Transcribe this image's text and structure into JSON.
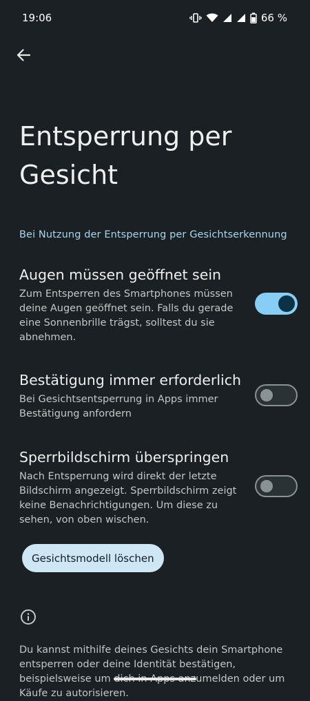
{
  "status_bar": {
    "time": "19:06",
    "battery_percent": "66 %",
    "icons": [
      "vibrate-icon",
      "wifi-icon",
      "signal-icon",
      "signal-icon",
      "battery-icon"
    ]
  },
  "nav": {
    "back_icon": "arrow-back-icon"
  },
  "page": {
    "title": "Entsperrung per Gesicht",
    "section_header": "Bei Nutzung der Entsperrung per Gesichtserkennung"
  },
  "settings": [
    {
      "title": "Augen müssen geöffnet sein",
      "summary": "Zum Entsperren des Smartphones müssen deine Augen geöffnet sein. Falls du gerade eine Sonnenbrille trägst, solltest du sie abnehmen.",
      "enabled": true
    },
    {
      "title": "Bestätigung immer erforderlich",
      "summary": "Bei Gesichtsentsperrung in Apps immer Bestätigung anfordern",
      "enabled": false
    },
    {
      "title": "Sperrbildschirm überspringen",
      "summary": "Nach Entsperrung wird direkt der letzte Bildschirm angezeigt. Sperrbildschirm zeigt keine Benachrichtigungen. Um diese zu sehen, von oben wischen.",
      "enabled": false
    }
  ],
  "actions": {
    "delete_model": "Gesichtsmodell löschen"
  },
  "info": {
    "icon": "info-icon",
    "text": "Du kannst mithilfe deines Gesichts dein Smartphone entsperren oder deine Identität bestätigen, beispielsweise um dich in Apps anzumelden oder um Käufe zu autorisieren."
  },
  "colors": {
    "background": "#1a2023",
    "accent": "#88cdf5",
    "section_header": "#a9d6ee",
    "button_bg": "#cfe6f4"
  }
}
